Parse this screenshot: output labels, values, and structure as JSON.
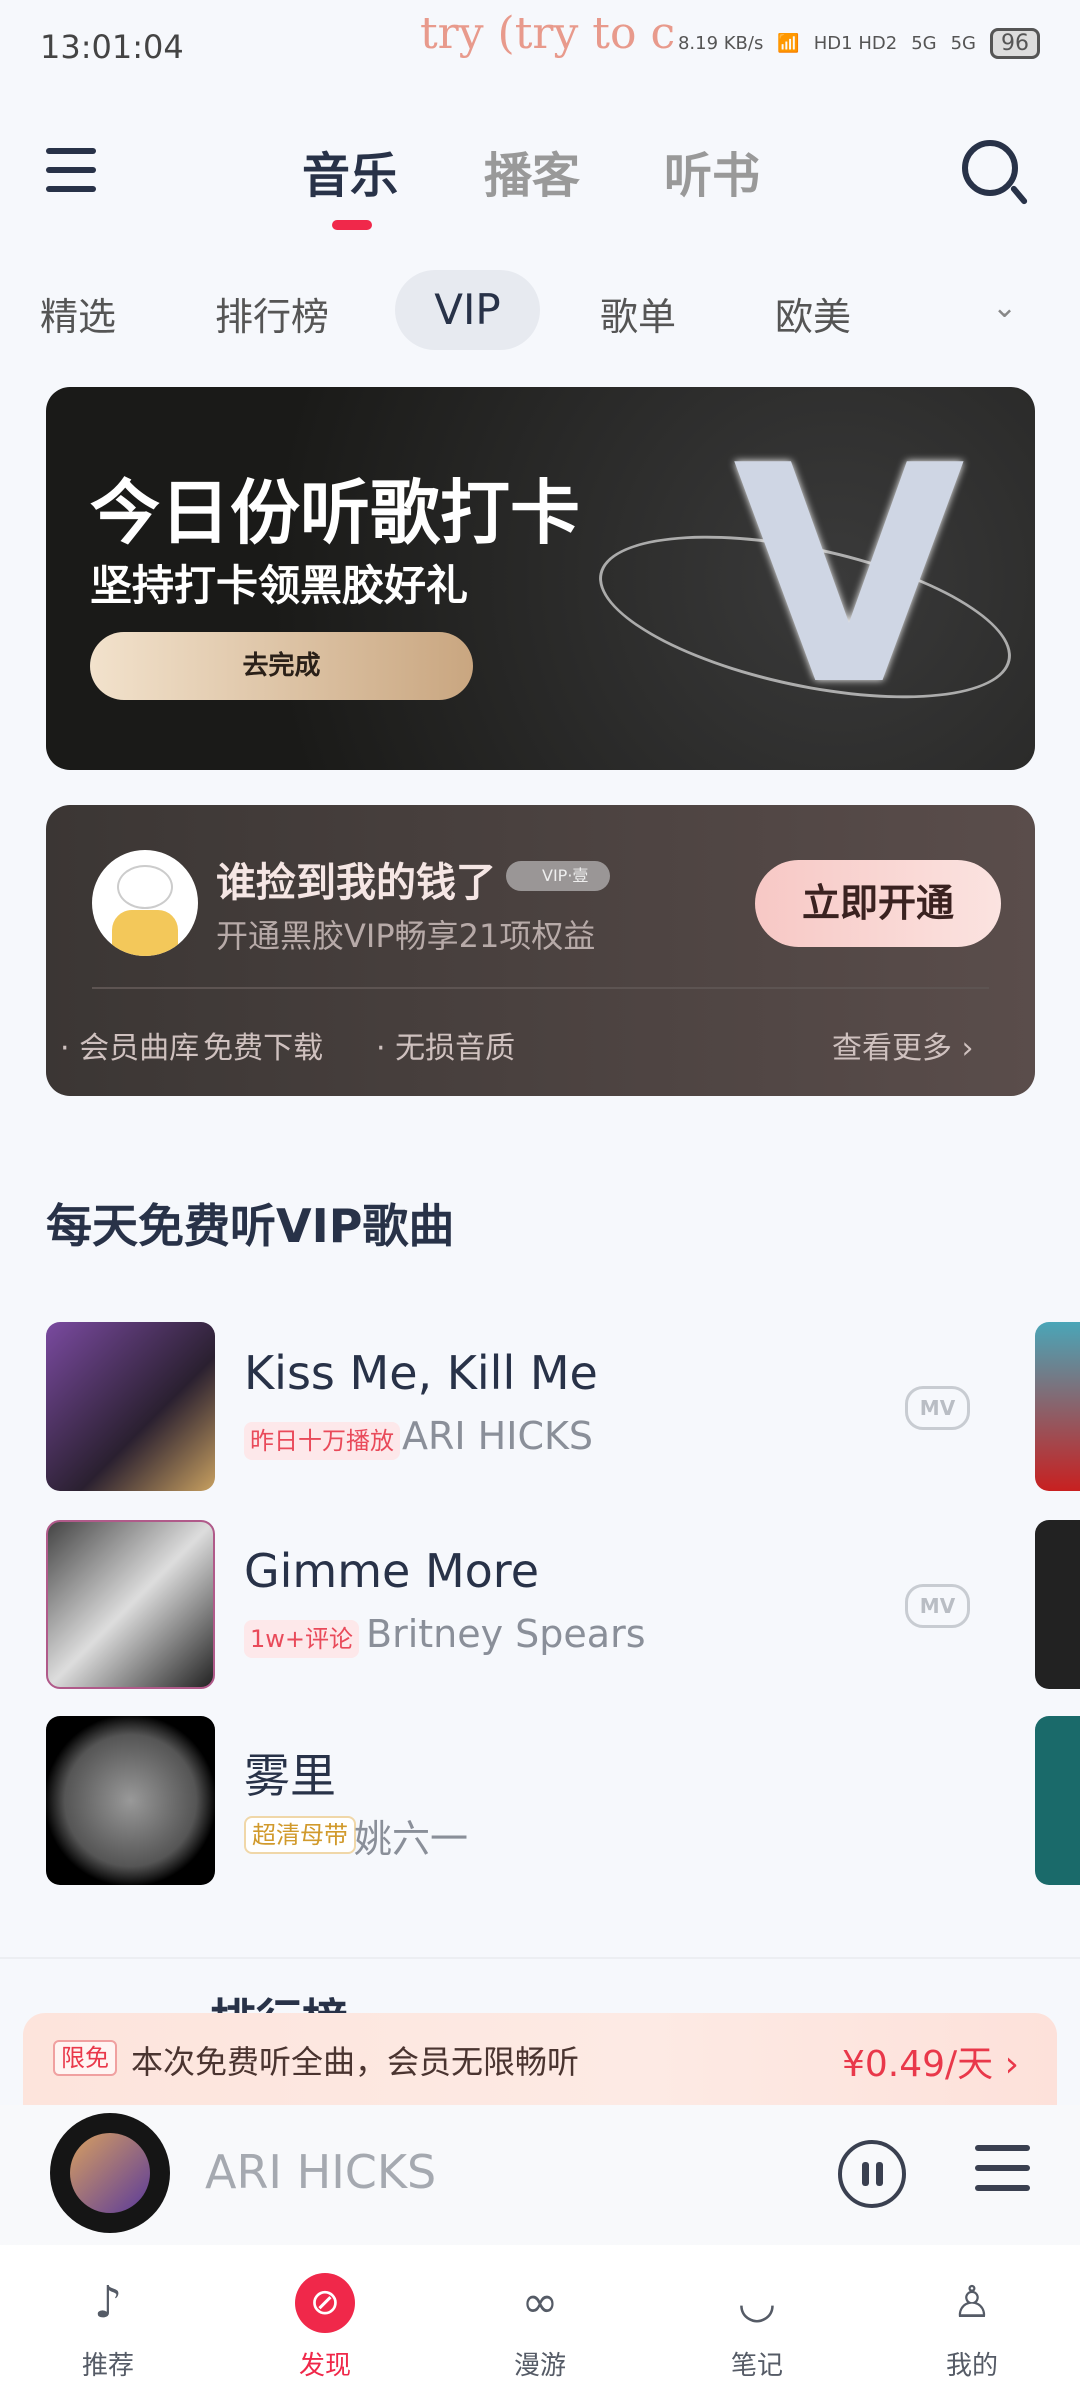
{
  "status_bar": {
    "time": "13:01:04",
    "ticker": "try (try to c",
    "net_speed": "8.19 KB/s",
    "hd": "HD1 HD2",
    "signal1": "5G",
    "signal2": "5G",
    "battery": "96"
  },
  "top_tabs": [
    {
      "label": "音乐",
      "active": true
    },
    {
      "label": "播客"
    },
    {
      "label": "听书"
    }
  ],
  "categories": [
    {
      "label": "精选"
    },
    {
      "label": "排行榜"
    },
    {
      "label": "VIP",
      "active": true
    },
    {
      "label": "歌单"
    },
    {
      "label": "欧美"
    }
  ],
  "banner": {
    "title": "今日份听歌打卡",
    "subtitle": "坚持打卡领黑胶好礼",
    "button": "去完成"
  },
  "vip_card": {
    "username": "谁捡到我的钱了",
    "badge": "VIP·壹",
    "subtitle": "开通黑胶VIP畅享21项权益",
    "button": "立即开通",
    "perks": [
      "会员曲库",
      "免费下载",
      "无损音质"
    ],
    "more": "查看更多 ›"
  },
  "section_title": "每天免费听VIP歌曲",
  "songs": [
    {
      "title": "Kiss Me, Kill Me",
      "tag": "昨日十万播放",
      "artist": "ARI HICKS",
      "mv": "MV"
    },
    {
      "title": "Gimme More",
      "tag": "1w+评论",
      "artist": "Britney Spears",
      "mv": "MV"
    },
    {
      "title": "雾里",
      "tag": "超清母带",
      "artist": "姚六一"
    }
  ],
  "next_section_partial": "排行榜",
  "promo": {
    "tag": "限免",
    "text": "本次免费听全曲，会员无限畅听",
    "price": "¥0.49/天 ›"
  },
  "player": {
    "artist": "ARI HICKS"
  },
  "bottom_nav": [
    {
      "label": "推荐",
      "icon": "netease-logo-icon"
    },
    {
      "label": "发现",
      "icon": "compass-icon",
      "active": true
    },
    {
      "label": "漫游",
      "icon": "radio-icon"
    },
    {
      "label": "笔记",
      "icon": "chat-icon"
    },
    {
      "label": "我的",
      "icon": "user-vip-icon"
    }
  ],
  "colors": {
    "accent": "#f0284a",
    "text": "#283248"
  }
}
